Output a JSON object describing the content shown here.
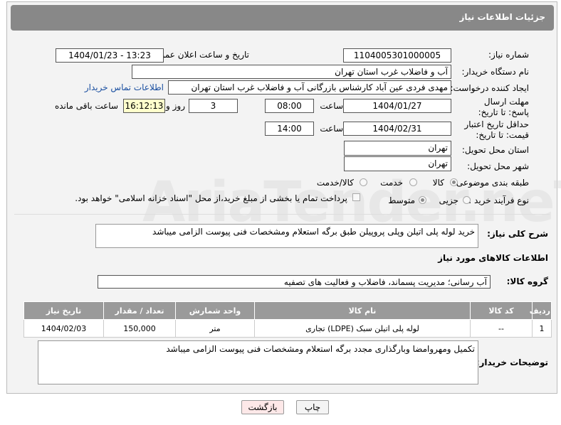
{
  "header_title": "جزئیات اطلاعات نیاز",
  "watermark": "AriaTender.neT",
  "fields": {
    "need_number_label": "شماره نیاز:",
    "need_number": "1104005301000005",
    "announce_label": "تاریخ و ساعت اعلان عمومی:",
    "announce_value": "1404/01/23 - 13:23",
    "buyer_org_label": "نام دستگاه خریدار:",
    "buyer_org": "آب و فاضلاب غرب استان تهران",
    "creator_label": "ایجاد کننده درخواست:",
    "creator": "مهدی فردی عین آباد کارشناس بازرگانی آب و فاضلاب غرب استان تهران",
    "buyer_contact_link": "اطلاعات تماس خریدار",
    "deadline_label": "مهلت ارسال پاسخ: تا تاریخ:",
    "deadline_date": "1404/01/27",
    "time_label": "ساعت",
    "deadline_time": "08:00",
    "days_count": "3",
    "days_label": "روز و",
    "remaining_time": "16:12:13",
    "remaining_label": "ساعت باقی مانده",
    "price_validity_label": "حداقل تاریخ اعتبار قیمت: تا تاریخ:",
    "price_validity_date": "1404/02/31",
    "price_validity_time": "14:00",
    "delivery_province_label": "استان محل تحویل:",
    "delivery_province": "تهران",
    "delivery_city_label": "شهر محل تحویل:",
    "delivery_city": "تهران",
    "category_label": "طبقه بندی موضوعی:",
    "category_options": [
      "کالا",
      "خدمت",
      "کالا/خدمت"
    ],
    "category_selected": "کالا",
    "process_label": "نوع فرآیند خرید :",
    "process_options": [
      "جزیی",
      "متوسط"
    ],
    "process_selected": "متوسط",
    "payment_note": "پرداخت تمام یا بخشی از مبلغ خرید،از محل \"اسناد خزانه اسلامی\" خواهد بود.",
    "summary_label": "شرح کلی نیاز:",
    "summary": "خرید لوله پلی اتیلن وپلی پروپیلن طبق برگه استعلام ومشخصات فنی پیوست الزامی میباشد",
    "goods_info_title": "اطلاعات کالاهای مورد نیاز",
    "goods_group_label": "گروه کالا:",
    "goods_group": "آب رسانی؛ مدیریت پسماند، فاضلاب و فعالیت های تصفیه",
    "buyer_notes_label": "توضیحات خریدار:",
    "buyer_notes": "تکمیل ومهروامضا وبارگذاری مجدد برگه استعلام ومشخصات فنی پیوست الزامی میباشد"
  },
  "table": {
    "headers": [
      "ردیف",
      "کد کالا",
      "نام کالا",
      "واحد شمارش",
      "تعداد / مقدار",
      "تاریخ نیاز"
    ],
    "rows": [
      [
        "1",
        "--",
        "لوله پلی اتیلن سبک (LDPE) تجاری",
        "متر",
        "150,000",
        "1404/02/03"
      ]
    ]
  },
  "buttons": {
    "print": "چاپ",
    "back": "بازگشت"
  },
  "colors": {
    "header_bg": "#888888",
    "table_header_bg": "#9a9a9a",
    "link": "#1a4fa0",
    "back_button_bg": "#fde8e8"
  }
}
